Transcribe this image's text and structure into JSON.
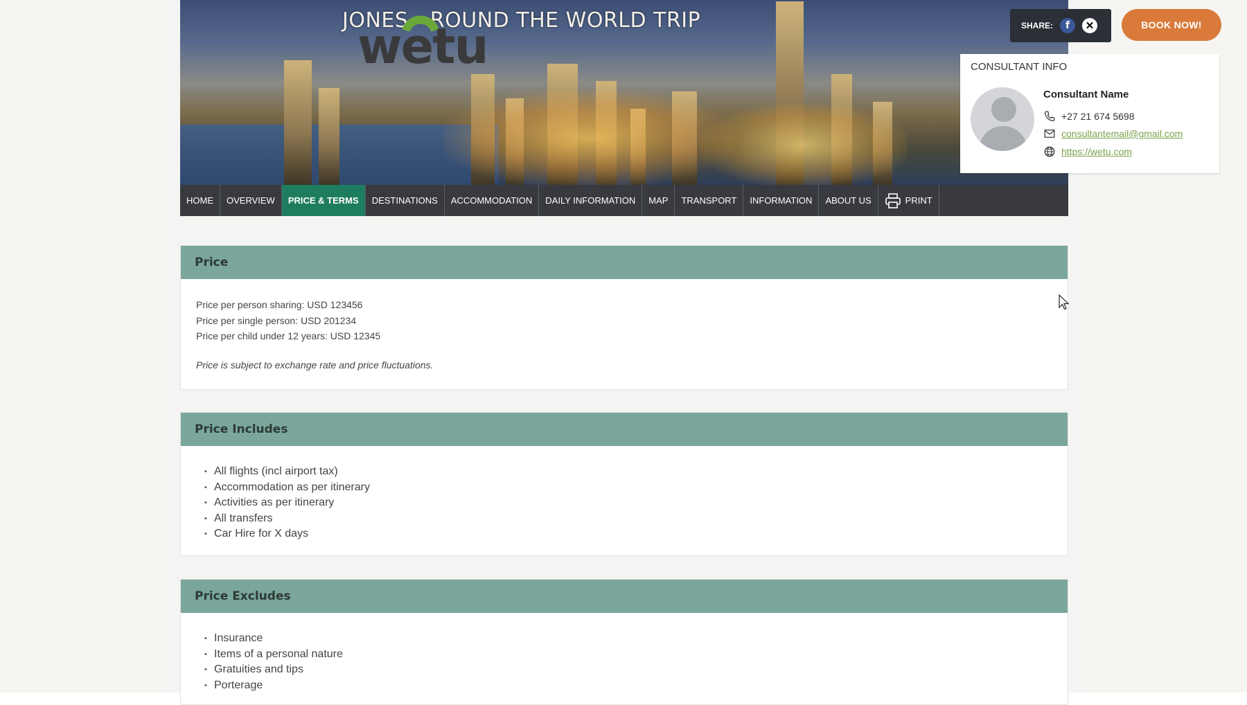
{
  "header": {
    "trip_title": "JONES - ROUND THE WORLD TRIP",
    "logo_text": "wetu",
    "share_label": "SHARE:",
    "share_icons": [
      "facebook-icon",
      "x-icon"
    ],
    "book_button": "BOOK NOW!"
  },
  "consultant": {
    "heading": "CONSULTANT INFO",
    "name": "Consultant Name",
    "phone": "+27 21 674 5698",
    "email": "consultantemail@gmail.com",
    "website": "https://wetu.com"
  },
  "nav": {
    "items": [
      {
        "label": "HOME"
      },
      {
        "label": "OVERVIEW"
      },
      {
        "label": "PRICE & TERMS",
        "active": true
      },
      {
        "label": "DESTINATIONS"
      },
      {
        "label": "ACCOMMODATION"
      },
      {
        "label": "DAILY INFORMATION"
      },
      {
        "label": "MAP"
      },
      {
        "label": "TRANSPORT"
      },
      {
        "label": "INFORMATION"
      },
      {
        "label": "ABOUT US"
      },
      {
        "label": "PRINT",
        "icon": "printer-icon"
      }
    ]
  },
  "price": {
    "title": "Price",
    "lines": [
      "Price per person sharing: USD 123456",
      "Price per single person: USD 201234",
      "Price per child under 12 years: USD 12345"
    ],
    "note": "Price is subject to exchange rate and price fluctuations."
  },
  "includes": {
    "title": "Price Includes",
    "items": [
      "All flights (incl airport tax)",
      "Accommodation as per itinerary",
      "Activities as per itinerary",
      "All transfers",
      "Car Hire for X days"
    ]
  },
  "excludes": {
    "title": "Price Excludes",
    "items": [
      "Insurance",
      "Items of a personal nature",
      "Gratuities and tips",
      "Porterage"
    ]
  },
  "colors": {
    "accent_green": "#1f7d5f",
    "section_header": "#7aa69b",
    "book_orange": "#d97a3b",
    "link_green": "#7aa24a"
  }
}
